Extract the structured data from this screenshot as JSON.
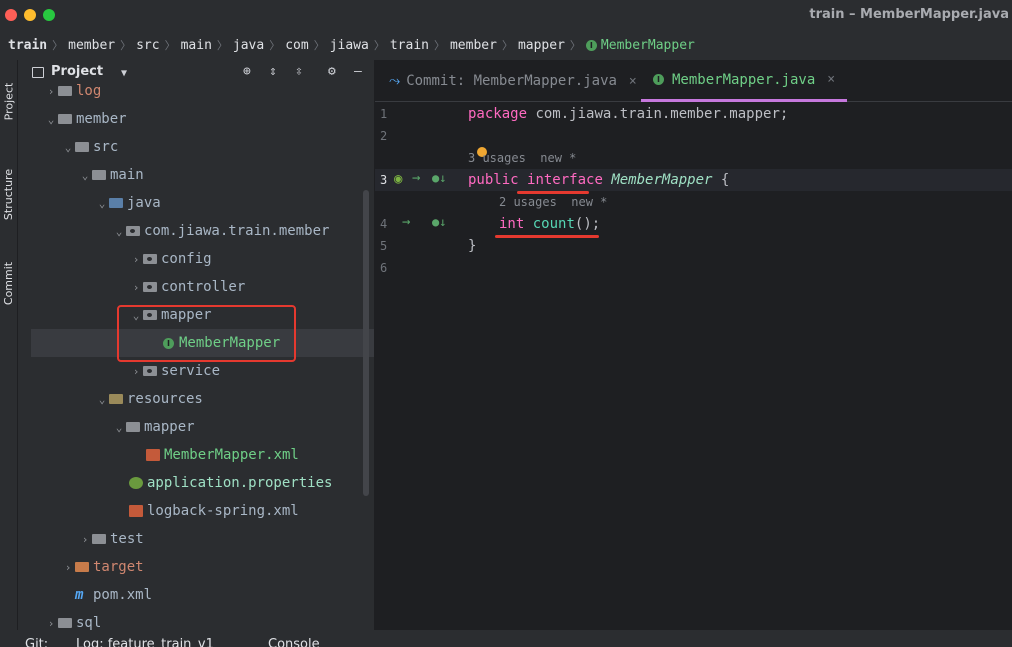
{
  "window": {
    "title": "train – MemberMapper.java",
    "controls": {
      "close_color": "#ff5f57",
      "minimize_color": "#febc2e",
      "maximize_color": "#28c840"
    }
  },
  "breadcrumbs": [
    "train",
    "member",
    "src",
    "main",
    "java",
    "com",
    "jiawa",
    "train",
    "member",
    "mapper",
    "MemberMapper"
  ],
  "tool_stripe": {
    "items": [
      "Project",
      "Structure",
      "Commit"
    ]
  },
  "project_panel": {
    "title": "Project",
    "header_icons": [
      "locate-icon",
      "expand-all-icon",
      "collapse-all-icon",
      "gear-icon",
      "minimize-icon"
    ],
    "tree": [
      {
        "label": "log",
        "depth": 1,
        "expanded": false,
        "icon": "folder-icon",
        "color": "orange"
      },
      {
        "label": "member",
        "depth": 1,
        "expanded": true,
        "icon": "module-folder-icon",
        "color": "default"
      },
      {
        "label": "src",
        "depth": 2,
        "expanded": true,
        "icon": "folder-icon",
        "color": "default"
      },
      {
        "label": "main",
        "depth": 3,
        "expanded": true,
        "icon": "folder-icon",
        "color": "default"
      },
      {
        "label": "java",
        "depth": 4,
        "expanded": true,
        "icon": "source-folder-icon",
        "color": "default"
      },
      {
        "label": "com.jiawa.train.member",
        "depth": 5,
        "expanded": true,
        "icon": "package-icon",
        "color": "default"
      },
      {
        "label": "config",
        "depth": 6,
        "expanded": false,
        "icon": "package-icon",
        "color": "default"
      },
      {
        "label": "controller",
        "depth": 6,
        "expanded": false,
        "icon": "package-icon",
        "color": "default"
      },
      {
        "label": "mapper",
        "depth": 6,
        "expanded": true,
        "icon": "package-icon",
        "color": "default"
      },
      {
        "label": "MemberMapper",
        "depth": 7,
        "expanded": null,
        "icon": "interface-icon",
        "color": "green",
        "selected": true
      },
      {
        "label": "service",
        "depth": 6,
        "expanded": false,
        "icon": "package-icon",
        "color": "default"
      },
      {
        "label": "resources",
        "depth": 4,
        "expanded": true,
        "icon": "resources-folder-icon",
        "color": "default"
      },
      {
        "label": "mapper",
        "depth": 5,
        "expanded": true,
        "icon": "folder-icon",
        "color": "default"
      },
      {
        "label": "MemberMapper.xml",
        "depth": 6,
        "expanded": null,
        "icon": "xml-file-icon",
        "color": "green"
      },
      {
        "label": "application.properties",
        "depth": 5,
        "expanded": null,
        "icon": "properties-file-icon",
        "color": "mint"
      },
      {
        "label": "logback-spring.xml",
        "depth": 5,
        "expanded": null,
        "icon": "xml-file-icon",
        "color": "default"
      },
      {
        "label": "test",
        "depth": 3,
        "expanded": false,
        "icon": "folder-icon",
        "color": "default"
      },
      {
        "label": "target",
        "depth": 2,
        "expanded": false,
        "icon": "folder-icon",
        "color": "orange"
      },
      {
        "label": "pom.xml",
        "depth": 2,
        "expanded": null,
        "icon": "maven-icon",
        "color": "default"
      },
      {
        "label": "sql",
        "depth": 1,
        "expanded": false,
        "icon": "folder-icon",
        "color": "default"
      }
    ]
  },
  "editor": {
    "tabs": [
      {
        "label": "Commit: MemberMapper.java",
        "active": false,
        "close": "×"
      },
      {
        "label": "MemberMapper.java",
        "active": true,
        "close": "×"
      }
    ],
    "line_numbers": [
      "1",
      "2",
      "3",
      "4",
      "5",
      "6"
    ],
    "lines": {
      "l1": {
        "kw": "package",
        "rest": " com.jiawa.train.member.mapper;"
      },
      "hint_usages_1": "3 usages  new *",
      "l3": {
        "kw": "public",
        "kw2": "interface",
        "name": "MemberMapper",
        "rest": " {"
      },
      "hint_usages_2": "2 usages  new *",
      "l4": {
        "type": "int",
        "method": "count",
        "rest": "();"
      },
      "l5": "}"
    }
  },
  "statusbar": {
    "items": [
      "Git:",
      "Log: feature_train_v1",
      "Console"
    ]
  }
}
